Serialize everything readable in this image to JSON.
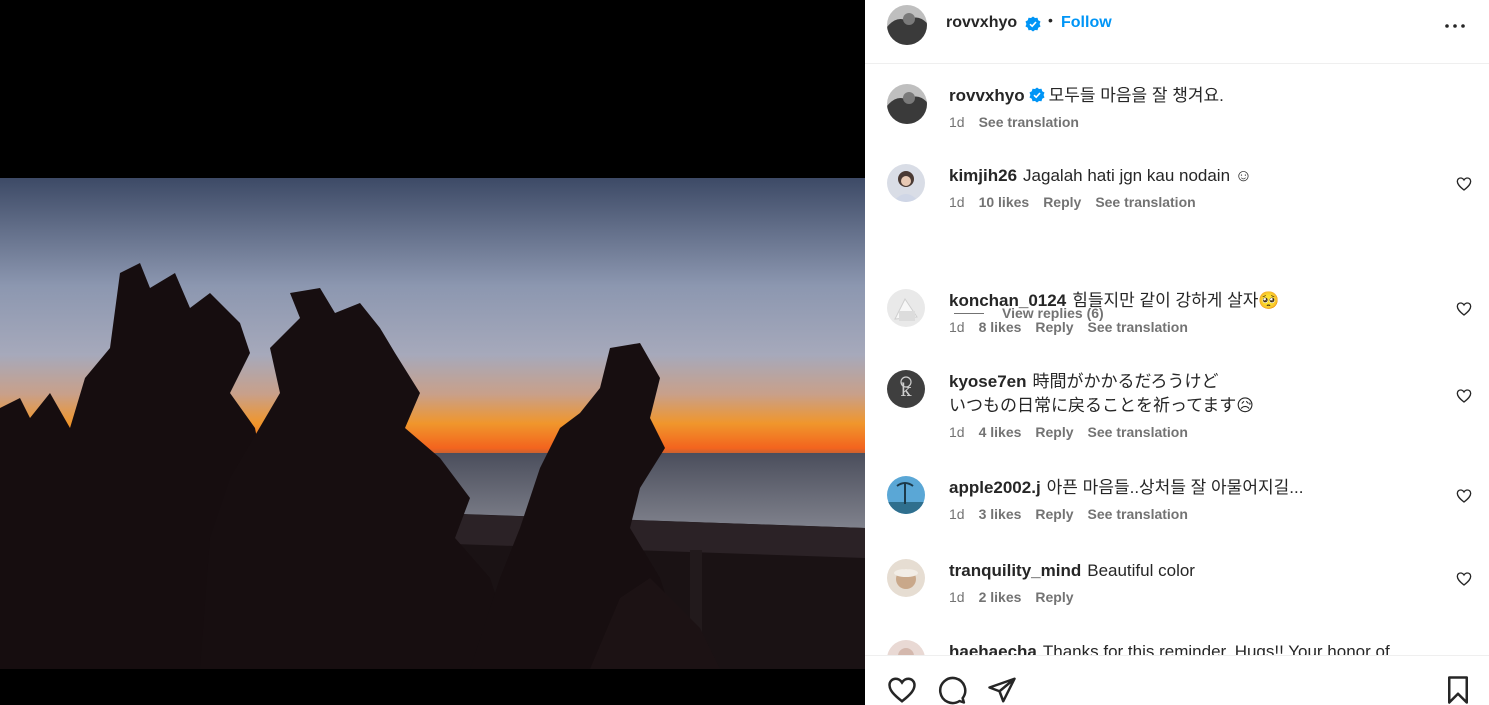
{
  "post": {
    "author": "rovvxhyo",
    "follow_label": "Follow",
    "separator": "•",
    "caption": "모두들 마음을 잘 챙겨요.",
    "caption_time": "1d",
    "see_translation": "See translation"
  },
  "comments": [
    {
      "user": "kimjih26",
      "text": "Jagalah hati jgn kau nodain ☺",
      "time": "1d",
      "likes": "10 likes",
      "reply": "Reply",
      "translation": "See translation"
    },
    {
      "user": "konchan_0124",
      "text": "힘들지만 같이 강하게 살자🥺",
      "time": "1d",
      "likes": "8 likes",
      "reply": "Reply",
      "translation": "See translation"
    },
    {
      "user": "kyose7en",
      "text": "時間がかかるだろうけど",
      "text2": "いつもの日常に戻ることを祈ってます😥",
      "time": "1d",
      "likes": "4 likes",
      "reply": "Reply",
      "translation": "See translation"
    },
    {
      "user": "apple2002.j",
      "text": "아픈 마음들..상처들 잘 아물어지길...",
      "time": "1d",
      "likes": "3 likes",
      "reply": "Reply",
      "translation": "See translation"
    },
    {
      "user": "tranquility_mind",
      "text": "Beautiful color",
      "time": "1d",
      "likes": "2 likes",
      "reply": "Reply"
    },
    {
      "user": "haehaecha",
      "text": "Thanks for this reminder. Hugs!! Your honor of"
    }
  ],
  "view_replies": "View replies (6)",
  "icons": {
    "more": "more-options-icon",
    "verified": "verified-badge-icon",
    "like": "heart-icon",
    "comment": "comment-icon",
    "share": "share-icon",
    "save": "bookmark-icon"
  },
  "colors": {
    "accent": "#0095f6",
    "verified": "#0095f6",
    "text": "#262626",
    "muted": "#737373"
  }
}
